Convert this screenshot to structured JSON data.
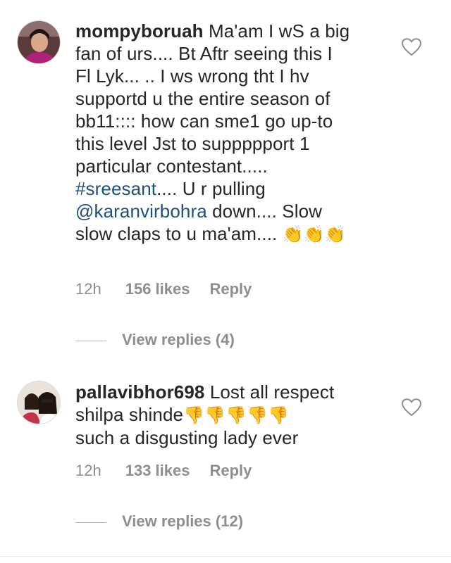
{
  "comments": [
    {
      "username": "mompyboruah",
      "text_lines": [
        "Ma'am I wS a big",
        "fan of urs.... Bt Aftr seeing this I",
        "Fl Lyk... .. I  ws wrong tht I hv",
        "supportd u the entire season of",
        "bb11:::: how can sme1 go up-to",
        "this level Jst to suppppport 1",
        "particular contestant....."
      ],
      "hashtag": "#sreesant",
      "after_hashtag": ".... U r pulling",
      "mention": "@karanvirbohra",
      "after_mention": " down.... Slow",
      "last_line": "slow claps to u ma'am.... ",
      "emoji": "👏👏👏",
      "time": "12h",
      "likes": "156 likes",
      "reply": "Reply",
      "view_replies": "View replies (4)"
    },
    {
      "username": "pallavibhor698",
      "text_first": "Lost all respect",
      "text_second": "shilpa shinde",
      "emoji": "👎👎👎👎👎",
      "text_third": "such a disgusting lady ever",
      "time": "12h",
      "likes": "133 likes",
      "reply": "Reply",
      "view_replies": "View replies (12)"
    }
  ],
  "icons": {
    "like": "heart-outline-icon"
  },
  "colors": {
    "text": "#262626",
    "muted": "#8e8e8e",
    "link": "#1f4f7a",
    "emoji": "#f2b11d"
  }
}
